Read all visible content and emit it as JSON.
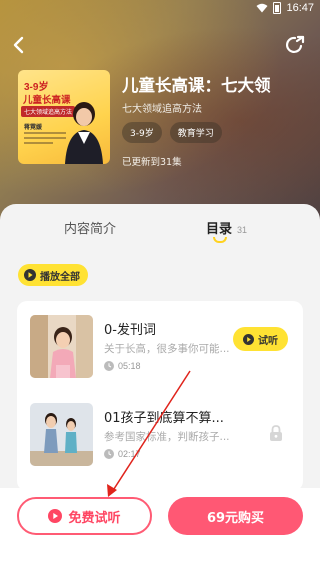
{
  "status_bar": {
    "time": "16:47"
  },
  "course": {
    "title": "儿童长高课：七大领",
    "subtitle": "七大领域追高方法",
    "tags": [
      "3-9岁",
      "教育学习"
    ],
    "update_text": "已更新到31集",
    "cover": {
      "age": "3-9岁",
      "title": "儿童长高课",
      "ribbon": "七大领域追高方法",
      "teacher": "蒋霓媛"
    }
  },
  "tabs": {
    "intro": "内容简介",
    "catalog": "目录",
    "catalog_count": "31"
  },
  "play_all_label": "播放全部",
  "episodes": [
    {
      "title": "0-发刊词",
      "desc": "关于长高，很多事你可能...",
      "duration": "05:18",
      "badge": "试听"
    },
    {
      "title": "01孩子到底算不算...",
      "desc": "参考国家标准，判断孩子...",
      "duration": "02:17"
    }
  ],
  "bottom": {
    "trial_label": "免费试听",
    "buy_label": "69元购买"
  },
  "colors": {
    "accent_yellow": "#ffe233",
    "accent_pink": "#ff5874",
    "annotation_red": "#e0241c"
  }
}
